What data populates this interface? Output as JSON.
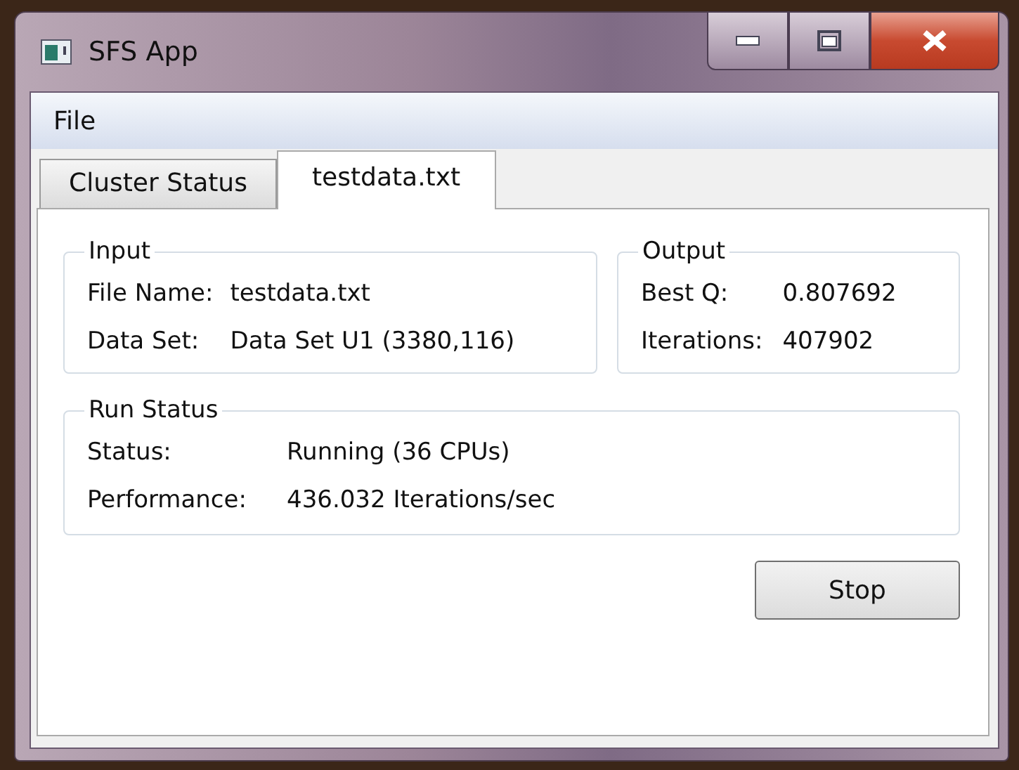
{
  "window": {
    "title": "SFS App"
  },
  "menu": [
    "File"
  ],
  "tabs": [
    {
      "label": "Cluster Status",
      "selected": false
    },
    {
      "label": "testdata.txt",
      "selected": true
    }
  ],
  "input": {
    "title": "Input",
    "fields": [
      {
        "label": "File Name:",
        "value": "testdata.txt"
      },
      {
        "label": "Data Set:",
        "value": "Data Set U1 (3380,116)"
      }
    ]
  },
  "output": {
    "title": "Output",
    "fields": [
      {
        "label": "Best Q:",
        "value": "0.807692"
      },
      {
        "label": "Iterations:",
        "value": "407902"
      }
    ]
  },
  "run_status": {
    "title": "Run Status",
    "fields": [
      {
        "label": "Status:",
        "value": "Running (36 CPUs)"
      },
      {
        "label": "Performance:",
        "value": "436.032 Iterations/sec"
      }
    ]
  },
  "buttons": [
    "Stop"
  ]
}
